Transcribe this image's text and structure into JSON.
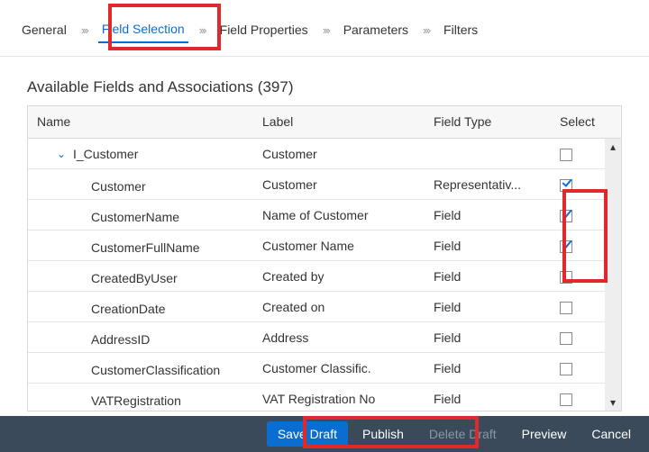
{
  "breadcrumb": {
    "items": [
      {
        "label": "General",
        "active": false
      },
      {
        "label": "Field Selection",
        "active": true
      },
      {
        "label": "Field Properties",
        "active": false
      },
      {
        "label": "Parameters",
        "active": false
      },
      {
        "label": "Filters",
        "active": false
      }
    ]
  },
  "section": {
    "title_prefix": "Available Fields and Associations",
    "count": "397"
  },
  "table": {
    "columns": {
      "name": "Name",
      "label": "Label",
      "type": "Field Type",
      "select": "Select"
    },
    "rows": [
      {
        "indent": 1,
        "expander": "v",
        "name": "I_Customer",
        "label": "Customer",
        "type": "",
        "selected": false
      },
      {
        "indent": 2,
        "expander": "",
        "name": "Customer",
        "label": "Customer",
        "type": "Representativ...",
        "selected": true
      },
      {
        "indent": 2,
        "expander": "",
        "name": "CustomerName",
        "label": "Name of Customer",
        "type": "Field",
        "selected": true
      },
      {
        "indent": 2,
        "expander": "",
        "name": "CustomerFullName",
        "label": "Customer Name",
        "type": "Field",
        "selected": true
      },
      {
        "indent": 2,
        "expander": "",
        "name": "CreatedByUser",
        "label": "Created by",
        "type": "Field",
        "selected": false
      },
      {
        "indent": 2,
        "expander": "",
        "name": "CreationDate",
        "label": "Created on",
        "type": "Field",
        "selected": false
      },
      {
        "indent": 2,
        "expander": "",
        "name": "AddressID",
        "label": "Address",
        "type": "Field",
        "selected": false
      },
      {
        "indent": 2,
        "expander": "",
        "name": "CustomerClassification",
        "label": "Customer Classific.",
        "type": "Field",
        "selected": false
      },
      {
        "indent": 2,
        "expander": "",
        "name": "VATRegistration",
        "label": "VAT Registration No",
        "type": "Field",
        "selected": false
      }
    ]
  },
  "footer": {
    "save_draft": "Save Draft",
    "publish": "Publish",
    "delete_draft": "Delete Draft",
    "preview": "Preview",
    "cancel": "Cancel"
  }
}
